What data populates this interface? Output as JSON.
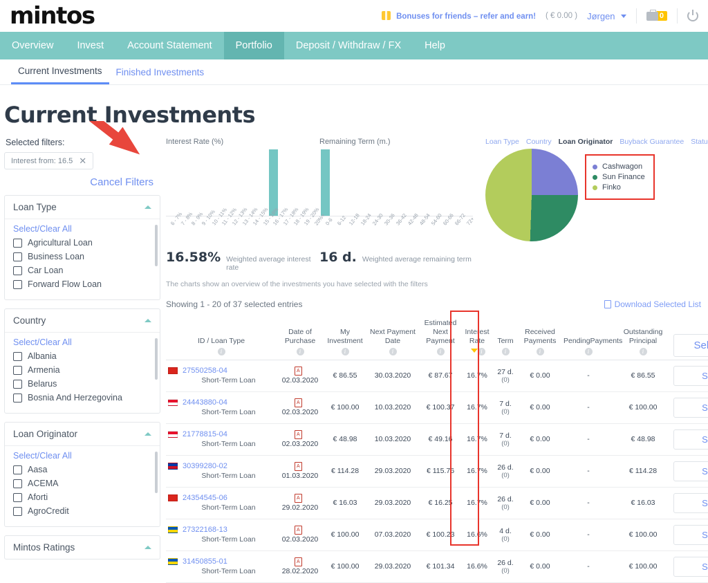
{
  "header": {
    "logo": "mintos",
    "bonus_link": "Bonuses for friends – refer and earn!",
    "balance": "( € 0.00 )",
    "user": "Jørgen",
    "briefcase_count": "0"
  },
  "nav": {
    "items": [
      {
        "label": "Overview",
        "active": false
      },
      {
        "label": "Invest",
        "active": false
      },
      {
        "label": "Account Statement",
        "active": false
      },
      {
        "label": "Portfolio",
        "active": true
      },
      {
        "label": "Deposit / Withdraw / FX",
        "active": false
      },
      {
        "label": "Help",
        "active": false
      }
    ]
  },
  "subnav": {
    "items": [
      {
        "label": "Current Investments",
        "active": true
      },
      {
        "label": "Finished Investments",
        "active": false
      }
    ]
  },
  "page": {
    "title": "Current Investments"
  },
  "filters": {
    "selected_label": "Selected filters:",
    "chip": "Interest from: 16.5",
    "chip_close": "✕",
    "cancel": "Cancel Filters",
    "select_clear": "Select/Clear All",
    "groups": [
      {
        "title": "Loan Type",
        "options": [
          "Agricultural Loan",
          "Business Loan",
          "Car Loan",
          "Forward Flow Loan"
        ]
      },
      {
        "title": "Country",
        "options": [
          "Albania",
          "Armenia",
          "Belarus",
          "Bosnia And Herzegovina"
        ]
      },
      {
        "title": "Loan Originator",
        "options": [
          "Aasa",
          "ACEMA",
          "Aforti",
          "AgroCredit"
        ]
      },
      {
        "title": "Mintos Ratings",
        "options": []
      }
    ]
  },
  "chart_data": [
    {
      "type": "bar",
      "title": "Interest Rate (%)",
      "categories": [
        "6 - 7%",
        "7 - 8%",
        "8 - 9%",
        "9 - 10%",
        "10 - 11%",
        "11 - 12%",
        "12 - 13%",
        "13 - 14%",
        "14 - 15%",
        "15 - 16%",
        "16 - 17%",
        "17 - 18%",
        "18 - 19%",
        "19 - 20%",
        "20%+"
      ],
      "values": [
        0,
        0,
        0,
        0,
        0,
        0,
        0,
        0,
        0,
        0,
        37,
        0,
        0,
        0,
        0
      ],
      "xlabel": "",
      "ylabel": "",
      "ylim": [
        0,
        37
      ],
      "summary_value": "16.58%",
      "summary_label": "Weighted average interest rate"
    },
    {
      "type": "bar",
      "title": "Remaining Term (m.)",
      "categories": [
        "0-6",
        "6-12",
        "12-18",
        "18-24",
        "24-30",
        "30-36",
        "36-42",
        "42-48",
        "48-54",
        "54-60",
        "60-66",
        "66-72",
        "72+"
      ],
      "values": [
        37,
        0,
        0,
        0,
        0,
        0,
        0,
        0,
        0,
        0,
        0,
        0,
        0
      ],
      "xlabel": "",
      "ylabel": "",
      "ylim": [
        0,
        37
      ],
      "summary_value": "16 d.",
      "summary_label": "Weighted average remaining term"
    },
    {
      "type": "pie",
      "title": "Loan Originator",
      "tabs": [
        "Loan Type",
        "Country",
        "Loan Originator",
        "Buyback Guarantee",
        "Status"
      ],
      "active_tab": "Loan Originator",
      "legend_position": "right",
      "labels": [
        "Cashwagon",
        "Sun Finance",
        "Finko"
      ],
      "values": [
        25,
        26,
        49
      ],
      "colors": [
        "#7b7fd4",
        "#2e8b63",
        "#b3cc5c"
      ]
    }
  ],
  "charts_note": "The charts show an overview of the investments you have selected with the filters",
  "table": {
    "showing": "Showing 1 - 20 of 37 selected entries",
    "download": "Download Selected List",
    "sell_all": "Sell All",
    "sell": "Sell",
    "columns": [
      "ID / Loan Type",
      "Date of Purchase",
      "My Investment",
      "Next Payment Date",
      "Estimated Next Payment",
      "Interest Rate",
      "Term",
      "Received Payments",
      "PendingPayments",
      "Outstanding Principal"
    ],
    "rows": [
      {
        "flag": "vn",
        "id": "27550258-04",
        "type": "Short-Term Loan",
        "purchase": "02.03.2020",
        "investment": "€ 86.55",
        "next_date": "30.03.2020",
        "next_payment": "€ 87.67",
        "rate": "16.7%",
        "term": "27 d.",
        "term_sub": "(0)",
        "received": "€ 0.00",
        "pending": "-",
        "outstanding": "€ 86.55"
      },
      {
        "flag": "id",
        "id": "24443880-04",
        "type": "Short-Term Loan",
        "purchase": "02.03.2020",
        "investment": "€ 100.00",
        "next_date": "10.03.2020",
        "next_payment": "€ 100.37",
        "rate": "16.7%",
        "term": "7 d.",
        "term_sub": "(0)",
        "received": "€ 0.00",
        "pending": "-",
        "outstanding": "€ 100.00"
      },
      {
        "flag": "id",
        "id": "21778815-04",
        "type": "Short-Term Loan",
        "purchase": "02.03.2020",
        "investment": "€ 48.98",
        "next_date": "10.03.2020",
        "next_payment": "€ 49.16",
        "rate": "16.7%",
        "term": "7 d.",
        "term_sub": "(0)",
        "received": "€ 0.00",
        "pending": "-",
        "outstanding": "€ 48.98"
      },
      {
        "flag": "ph",
        "id": "30399280-02",
        "type": "Short-Term Loan",
        "purchase": "01.03.2020",
        "investment": "€ 114.28",
        "next_date": "29.03.2020",
        "next_payment": "€ 115.76",
        "rate": "16.7%",
        "term": "26 d.",
        "term_sub": "(0)",
        "received": "€ 0.00",
        "pending": "-",
        "outstanding": "€ 114.28"
      },
      {
        "flag": "vn",
        "id": "24354545-06",
        "type": "Short-Term Loan",
        "purchase": "29.02.2020",
        "investment": "€ 16.03",
        "next_date": "29.03.2020",
        "next_payment": "€ 16.25",
        "rate": "16.7%",
        "term": "26 d.",
        "term_sub": "(0)",
        "received": "€ 0.00",
        "pending": "-",
        "outstanding": "€ 16.03"
      },
      {
        "flag": "ua",
        "id": "27322168-13",
        "type": "Short-Term Loan",
        "purchase": "02.03.2020",
        "investment": "€ 100.00",
        "next_date": "07.03.2020",
        "next_payment": "€ 100.23",
        "rate": "16.6%",
        "term": "4 d.",
        "term_sub": "(0)",
        "received": "€ 0.00",
        "pending": "-",
        "outstanding": "€ 100.00"
      },
      {
        "flag": "ua",
        "id": "31450855-01",
        "type": "Short-Term Loan",
        "purchase": "28.02.2020",
        "investment": "€ 100.00",
        "next_date": "29.03.2020",
        "next_payment": "€ 101.34",
        "rate": "16.6%",
        "term": "26 d.",
        "term_sub": "(0)",
        "received": "€ 0.00",
        "pending": "-",
        "outstanding": "€ 100.00"
      }
    ]
  }
}
